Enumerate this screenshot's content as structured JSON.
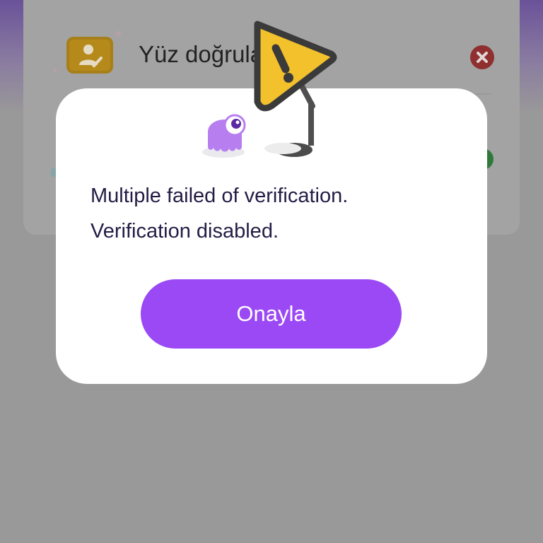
{
  "background": {
    "row_label": "Yüz doğrula",
    "icons": [
      "face-verify-icon",
      "fail-x-icon",
      "success-check-icon"
    ]
  },
  "dialog": {
    "message_line1": "Multiple failed of verification.",
    "message_line2": "Verification disabled.",
    "confirm_label": "Onayla",
    "icons": [
      "mascot-octopus-icon",
      "warning-sign-icon"
    ]
  },
  "colors": {
    "accent": "#9b49f5",
    "message_text": "#241c45",
    "warning_yellow": "#f3c12c"
  }
}
